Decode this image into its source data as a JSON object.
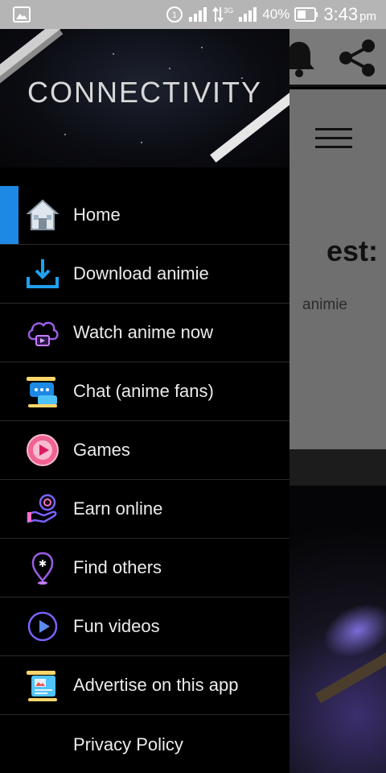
{
  "status_bar": {
    "signal_label": "3G",
    "battery": "40%",
    "time": "3:43",
    "ampm": "pm"
  },
  "app_background": {
    "heading_partial": "est:",
    "subtext_partial": "animie"
  },
  "drawer": {
    "title": "CONNECTIVITY",
    "items": [
      {
        "label": "Home",
        "icon": "home-icon",
        "active": true
      },
      {
        "label": "Download animie",
        "icon": "download-icon"
      },
      {
        "label": "Watch anime now",
        "icon": "cloud-play-icon"
      },
      {
        "label": "Chat (anime fans)",
        "icon": "chat-icon"
      },
      {
        "label": "Games",
        "icon": "play-circle-icon"
      },
      {
        "label": "Earn online",
        "icon": "coin-hand-icon"
      },
      {
        "label": "Find others",
        "icon": "location-pin-icon"
      },
      {
        "label": "Fun videos",
        "icon": "video-play-icon"
      },
      {
        "label": "Advertise on this app",
        "icon": "ad-board-icon"
      },
      {
        "label": "Privacy Policy",
        "icon": ""
      }
    ]
  },
  "colors": {
    "active_indicator": "#1e88e5",
    "drawer_bg": "#000000",
    "status_bar_bg": "#b5b5b5"
  }
}
